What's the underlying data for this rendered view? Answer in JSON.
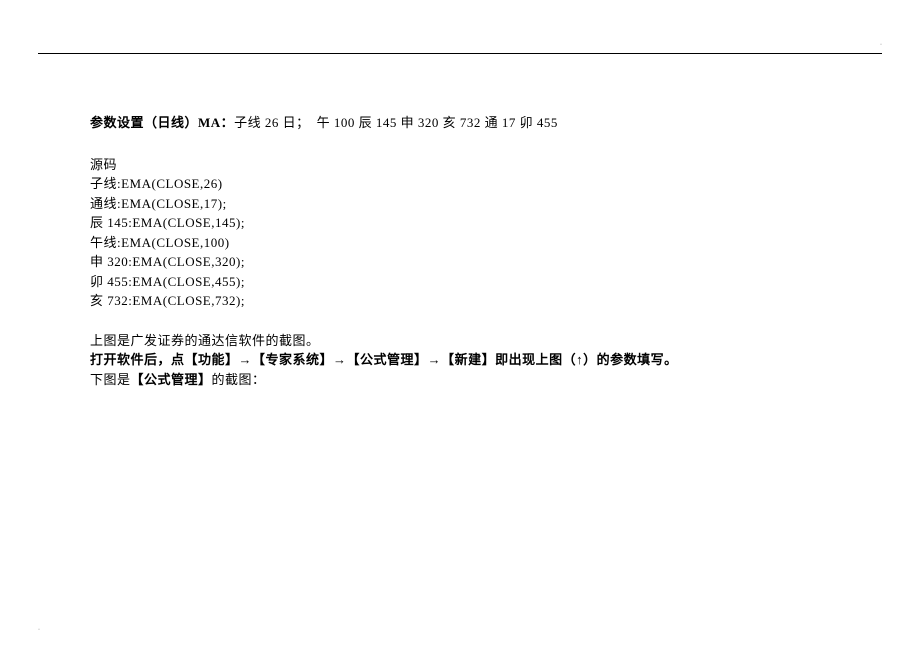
{
  "header_dot": "·",
  "footer_dot": "·",
  "param_settings": {
    "prefix": "参数设置（日线）MA：",
    "rest": "子线 26 日；　午 100 辰 145 申 320 亥 732 通 17 卯 455"
  },
  "source": {
    "title": "源码",
    "lines": [
      "子线:EMA(CLOSE,26)",
      "通线:EMA(CLOSE,17);",
      "辰 145:EMA(CLOSE,145);",
      "午线:EMA(CLOSE,100)",
      "申 320:EMA(CLOSE,320);",
      "卯 455:EMA(CLOSE,455);",
      "亥 732:EMA(CLOSE,732);"
    ]
  },
  "description": {
    "line1": "上图是广发证券的通达信软件的截图。",
    "line2_pre": "打开软件后，点",
    "line2_b1": "【功能】",
    "line2_arrow1": "→",
    "line2_b2": "【专家系统】",
    "line2_arrow2": "→",
    "line2_b3": "【公式管理】",
    "line2_arrow3": "→",
    "line2_b4": "【新建】",
    "line2_post": "即出现上图（↑）的参数填写。",
    "line3_pre": "下图是",
    "line3_b": "【公式管理】",
    "line3_post": "的截图："
  }
}
